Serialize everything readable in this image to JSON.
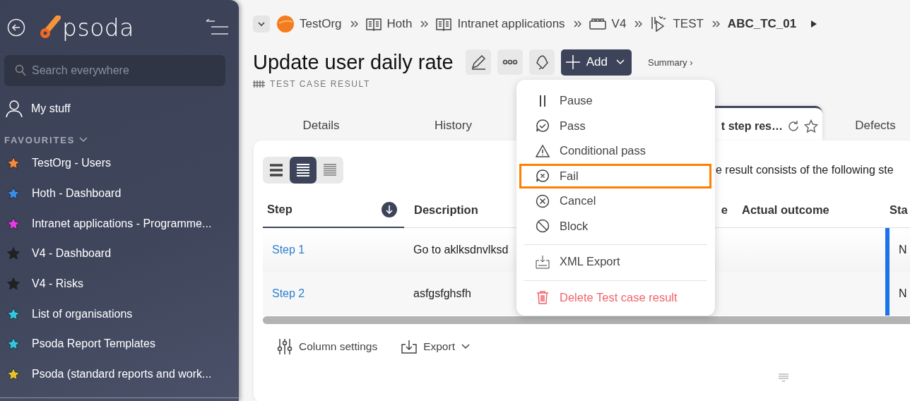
{
  "sidebar": {
    "logo": "psoda",
    "search": {
      "placeholder": "Search everywhere"
    },
    "my_stuff": "My stuff",
    "favourites_heading": "FAVOURITES",
    "favourites": [
      {
        "label": "TestOrg - Users",
        "color": "#f7893b"
      },
      {
        "label": "Hoth - Dashboard",
        "color": "#3b8be8"
      },
      {
        "label": "Intranet applications - Programme...",
        "color": "#e53be0"
      },
      {
        "label": "V4 - Dashboard",
        "color": "#222222"
      },
      {
        "label": "V4 - Risks",
        "color": "#222222"
      },
      {
        "label": "List of organisations",
        "color": "#33c6dd"
      },
      {
        "label": "Psoda Report Templates",
        "color": "#33c6dd"
      },
      {
        "label": "Psoda (standard reports and work...",
        "color": "#e8c22c"
      }
    ]
  },
  "breadcrumb": [
    {
      "kind": "org",
      "label": "TestOrg"
    },
    {
      "kind": "book",
      "label": "Hoth"
    },
    {
      "kind": "book",
      "label": "Intranet applications"
    },
    {
      "kind": "box",
      "label": "V4"
    },
    {
      "kind": "test",
      "label": "TEST"
    },
    {
      "kind": "current",
      "label": "ABC_TC_01"
    }
  ],
  "title": "Update user daily rate",
  "subtitle": "TEST CASE RESULT",
  "add_button": "Add",
  "summary_link": "Summary ›",
  "tabs": [
    {
      "label": "Details",
      "selected": false
    },
    {
      "label": "History",
      "selected": false
    },
    {
      "label": "t step res…",
      "selected": true
    },
    {
      "label": "Defects",
      "selected": false
    }
  ],
  "view_modes": [
    {
      "kind": "large",
      "selected": false
    },
    {
      "kind": "medium",
      "selected": true
    },
    {
      "kind": "compact",
      "selected": false
    }
  ],
  "intro": "e result consists of the following ste",
  "table": {
    "columns": [
      "Step",
      "Description",
      "e",
      "Actual outcome",
      "Sta"
    ],
    "rows": [
      {
        "step": "Step 1",
        "description": "Go to aklksdnvlksd",
        "status": "N"
      },
      {
        "step": "Step 2",
        "description": "asfgsfghsfh",
        "status": "N"
      }
    ]
  },
  "footer": {
    "column_settings": "Column settings",
    "export": "Export"
  },
  "menu": {
    "groups": [
      [
        {
          "kind": "pause",
          "label": "Pause",
          "selected": false
        },
        {
          "kind": "pass",
          "label": "Pass",
          "selected": false
        },
        {
          "kind": "conditional",
          "label": "Conditional pass",
          "selected": false
        },
        {
          "kind": "fail",
          "label": "Fail",
          "selected": true
        },
        {
          "kind": "cancel",
          "label": "Cancel",
          "selected": false
        },
        {
          "kind": "block",
          "label": "Block",
          "selected": false
        }
      ],
      [
        {
          "kind": "xml",
          "label": "XML Export",
          "selected": false
        }
      ],
      [
        {
          "kind": "delete",
          "label": "Delete Test case result",
          "selected": false
        }
      ]
    ]
  }
}
